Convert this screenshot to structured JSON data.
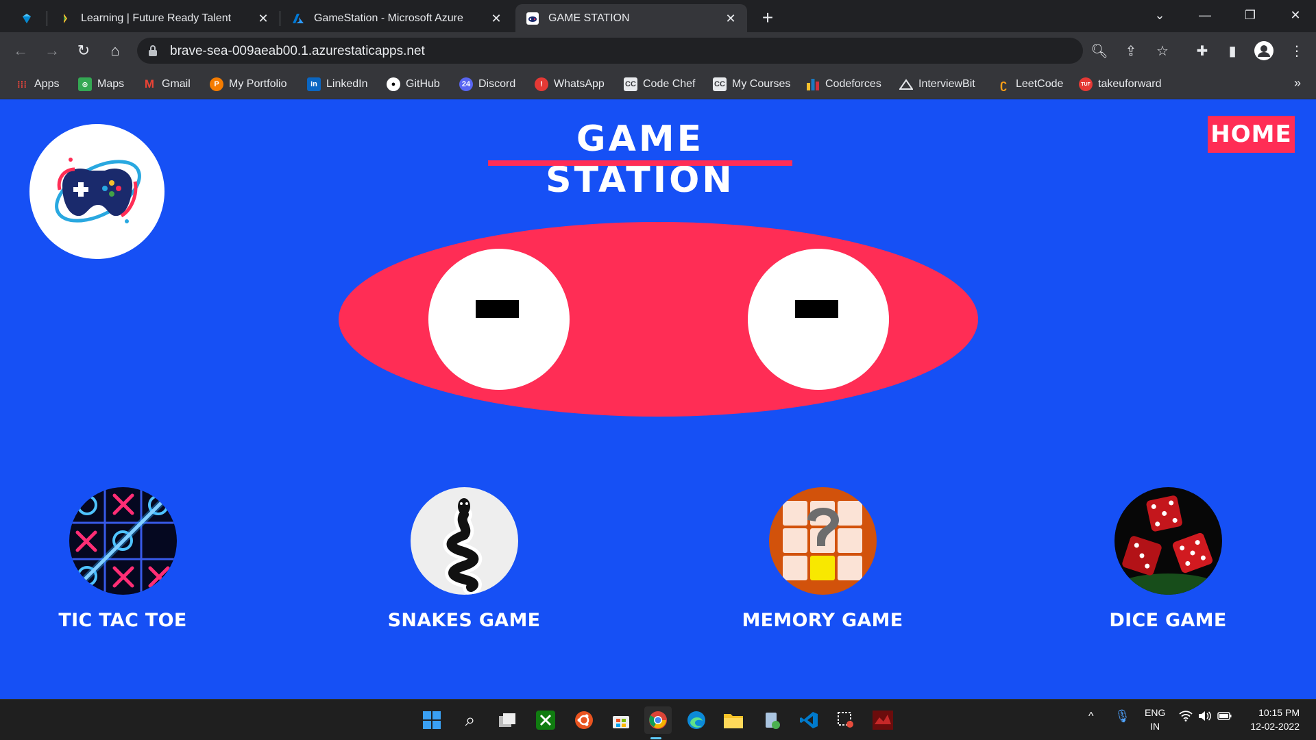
{
  "browser": {
    "tabs": [
      {
        "title": "",
        "icon": "gem-icon"
      },
      {
        "title": "Learning | Future Ready Talent",
        "icon": "frt-icon"
      },
      {
        "title": "GameStation - Microsoft Azure",
        "icon": "azure-icon"
      },
      {
        "title": "GAME STATION",
        "icon": "gamepad-icon",
        "active": true
      }
    ],
    "url": "brave-sea-009aeab00.1.azurestaticapps.net",
    "bookmarks": [
      {
        "label": "Apps",
        "icon": "apps-grid-icon"
      },
      {
        "label": "Maps",
        "icon": "maps-icon"
      },
      {
        "label": "Gmail",
        "icon": "gmail-icon"
      },
      {
        "label": "My Portfolio",
        "icon": "portfolio-icon"
      },
      {
        "label": "LinkedIn",
        "icon": "linkedin-icon"
      },
      {
        "label": "GitHub",
        "icon": "github-icon"
      },
      {
        "label": "Discord",
        "icon": "discord-icon"
      },
      {
        "label": "WhatsApp",
        "icon": "whatsapp-icon"
      },
      {
        "label": "Code Chef",
        "icon": "codechef-icon"
      },
      {
        "label": "My Courses",
        "icon": "courses-icon"
      },
      {
        "label": "Codeforces",
        "icon": "codeforces-icon"
      },
      {
        "label": "InterviewBit",
        "icon": "interviewbit-icon"
      },
      {
        "label": "LeetCode",
        "icon": "leetcode-icon"
      },
      {
        "label": "takeuforward",
        "icon": "tuf-icon"
      }
    ],
    "overflow_label": "»"
  },
  "page": {
    "title": "GAME STATION",
    "home_label": "HOME",
    "games": [
      {
        "label": "TIC TAC TOE",
        "icon": "tic-tac-toe-icon"
      },
      {
        "label": "SNAKES GAME",
        "icon": "snake-icon"
      },
      {
        "label": "MEMORY GAME",
        "icon": "memory-icon"
      },
      {
        "label": "DICE GAME",
        "icon": "dice-icon"
      }
    ]
  },
  "taskbar": {
    "language": "ENG",
    "region": "IN",
    "time": "10:15 PM",
    "date": "12-02-2022"
  },
  "colors": {
    "page_bg": "#1650f5",
    "accent": "#ff2d55",
    "chrome_dark": "#202124",
    "chrome_toolbar": "#35363a"
  }
}
